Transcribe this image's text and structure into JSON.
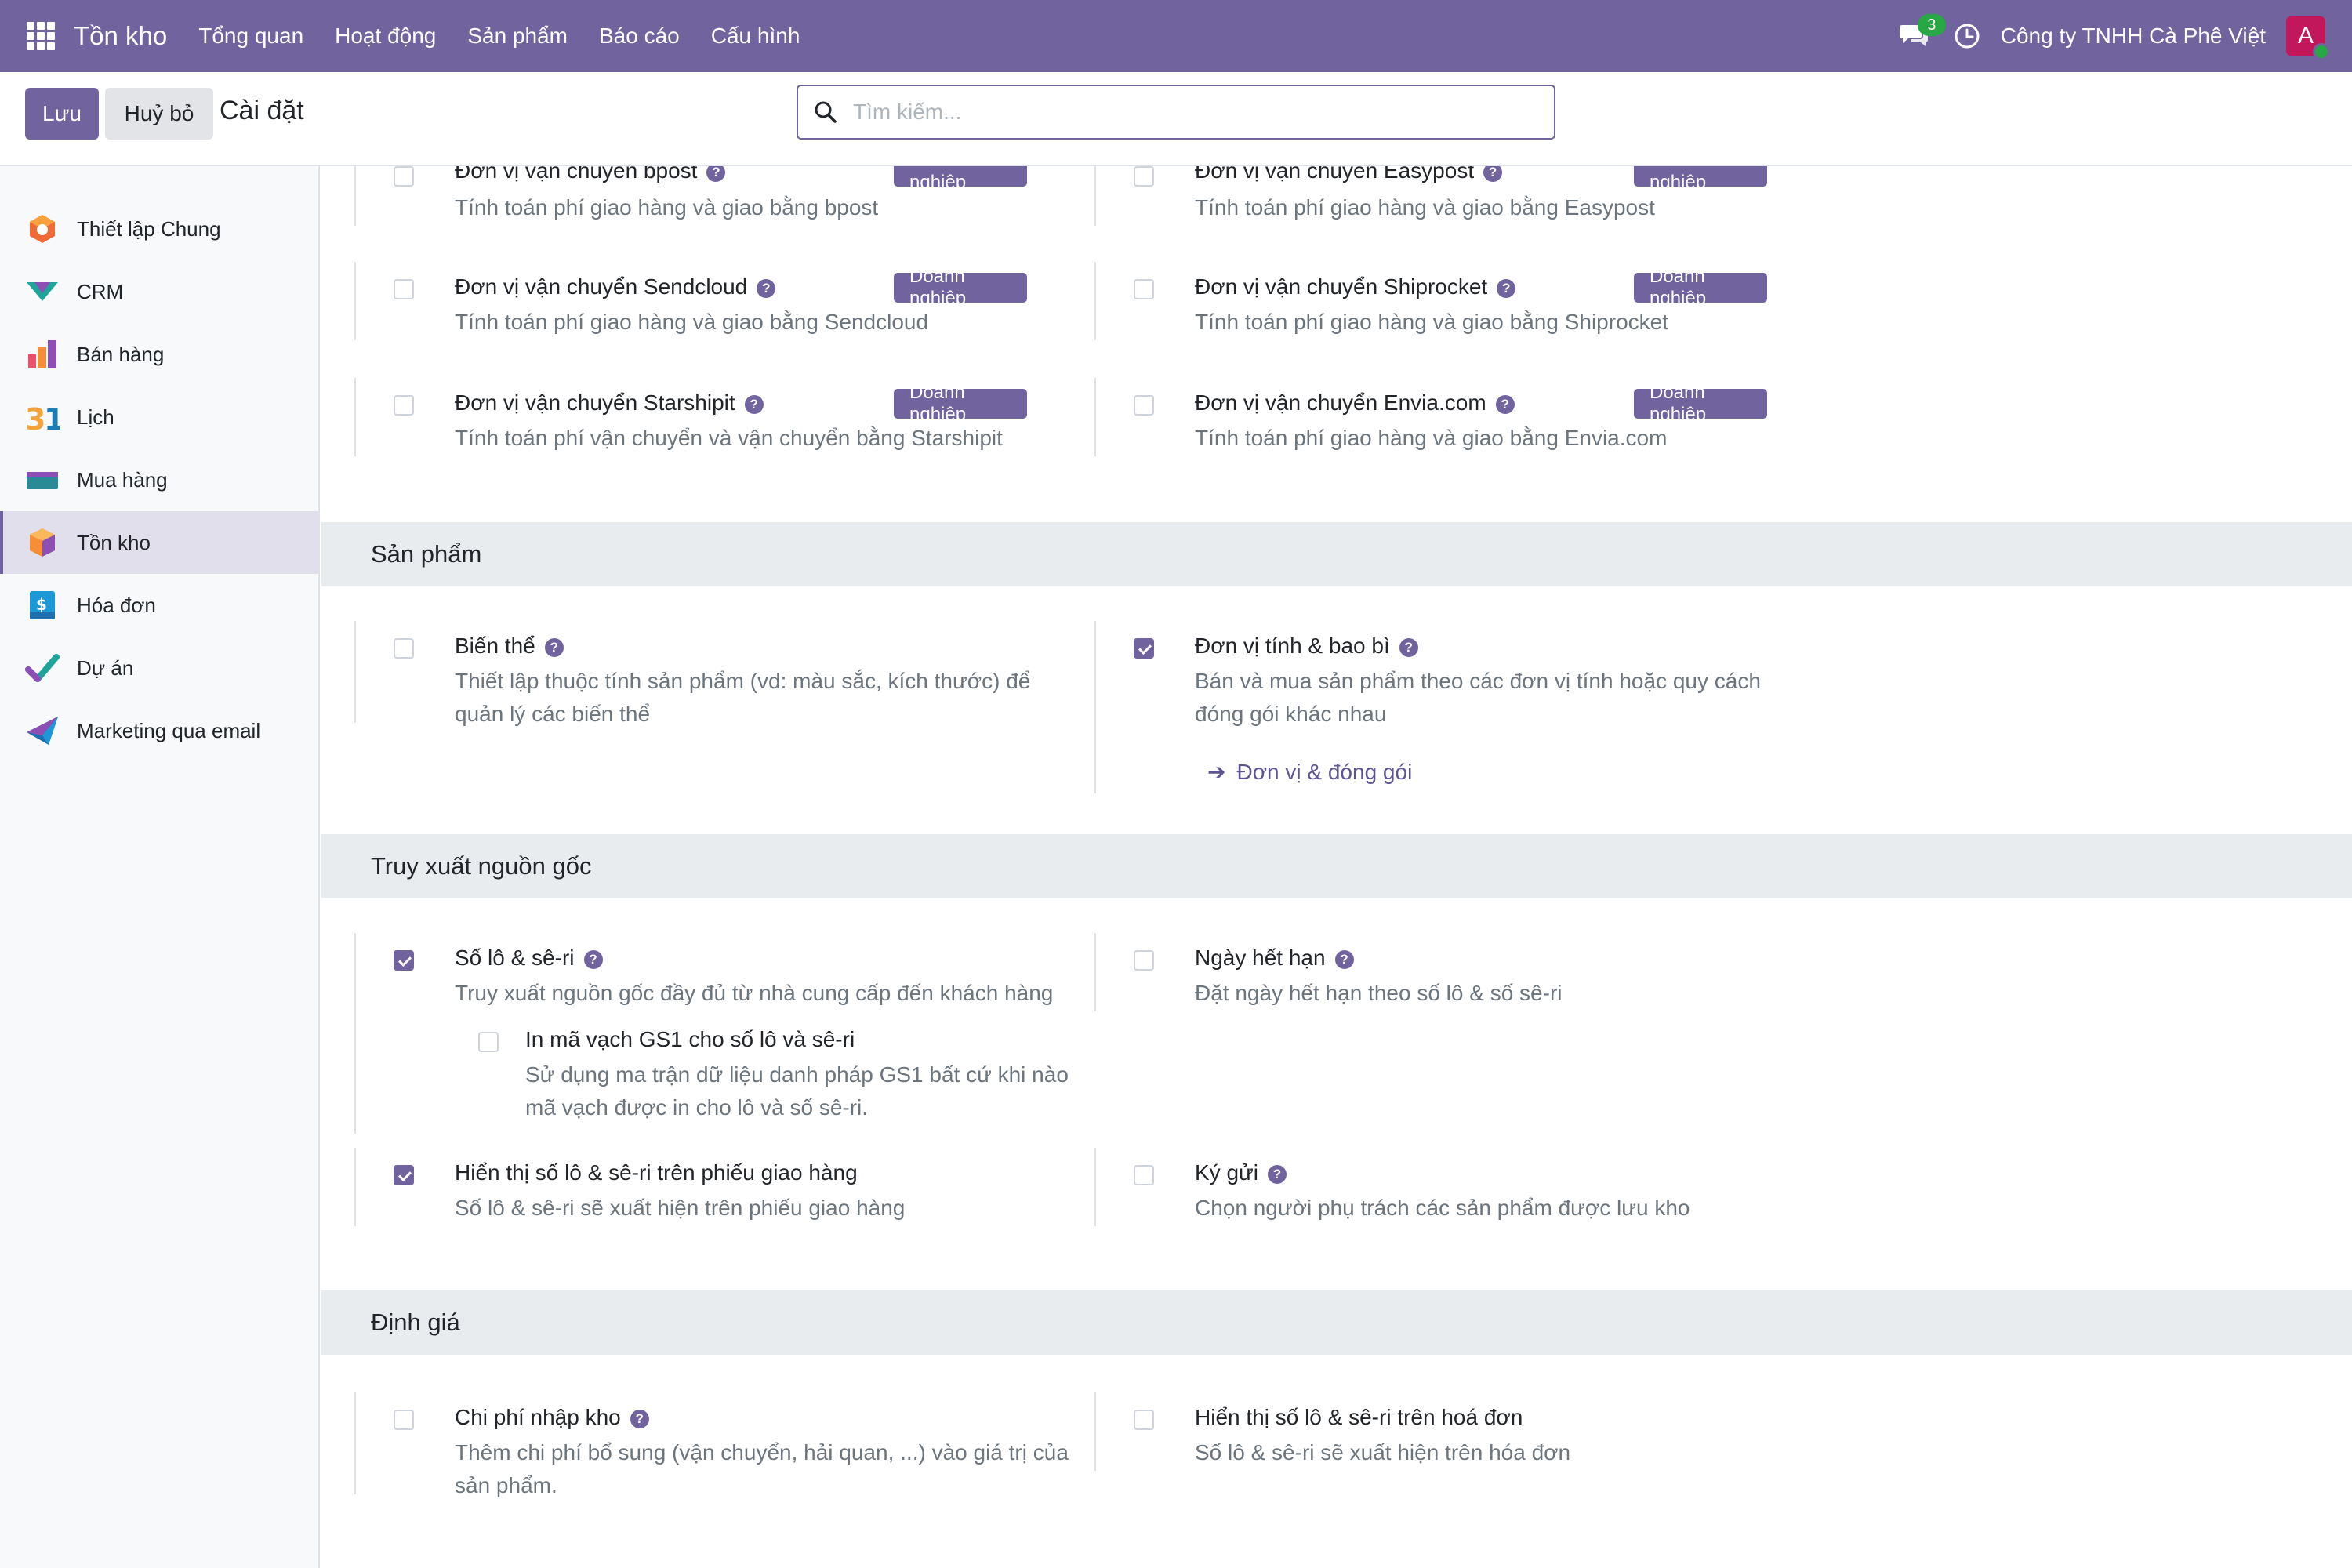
{
  "navbar": {
    "brand": "Tồn kho",
    "menu": [
      "Tổng quan",
      "Hoạt động",
      "Sản phẩm",
      "Báo cáo",
      "Cấu hình"
    ],
    "chat_count": "3",
    "company": "Công ty TNHH Cà Phê Việt",
    "avatar_letter": "A"
  },
  "control": {
    "save_label": "Lưu",
    "cancel_label": "Huỷ bỏ",
    "title": "Cài đặt",
    "search_placeholder": "Tìm kiếm..."
  },
  "sidebar": {
    "items": [
      {
        "label": "Thiết lập Chung",
        "icon": "settings-app-icon"
      },
      {
        "label": "CRM",
        "icon": "crm-app-icon"
      },
      {
        "label": "Bán hàng",
        "icon": "sales-app-icon"
      },
      {
        "label": "Lịch",
        "icon": "calendar-app-icon"
      },
      {
        "label": "Mua hàng",
        "icon": "purchase-app-icon"
      },
      {
        "label": "Tồn kho",
        "icon": "inventory-app-icon",
        "active": true
      },
      {
        "label": "Hóa đơn",
        "icon": "invoicing-app-icon"
      },
      {
        "label": "Dự án",
        "icon": "project-app-icon"
      },
      {
        "label": "Marketing qua email",
        "icon": "email-marketing-app-icon"
      }
    ]
  },
  "shipping": {
    "bpost": {
      "title": "Đơn vị vận chuyển bpost",
      "desc": "Tính toán phí giao hàng và giao bằng bpost",
      "badge": "Doanh nghiệp",
      "checked": false
    },
    "easypost": {
      "title": "Đơn vị vận chuyển Easypost",
      "desc": "Tính toán phí giao hàng và giao bằng Easypost",
      "badge": "Doanh nghiệp",
      "checked": false
    },
    "sendcloud": {
      "title": "Đơn vị vận chuyển Sendcloud",
      "desc": "Tính toán phí giao hàng và giao bằng Sendcloud",
      "badge": "Doanh nghiệp",
      "checked": false
    },
    "shiprocket": {
      "title": "Đơn vị vận chuyển Shiprocket",
      "desc": "Tính toán phí giao hàng và giao bằng Shiprocket",
      "badge": "Doanh nghiệp",
      "checked": false
    },
    "starshipit": {
      "title": "Đơn vị vận chuyển Starshipit",
      "desc": "Tính toán phí vận chuyển và vận chuyển bằng Starshipit",
      "badge": "Doanh nghiệp",
      "checked": false
    },
    "envia": {
      "title": "Đơn vị vận chuyển Envia.com",
      "desc": "Tính toán phí giao hàng và giao bằng Envia.com",
      "badge": "Doanh nghiệp",
      "checked": false
    }
  },
  "products": {
    "heading": "Sản phẩm",
    "variants": {
      "title": "Biến thể",
      "desc1": "Thiết lập thuộc tính sản phẩm (vd: màu sắc, kích thước) để",
      "desc2": "quản lý các biến thể",
      "checked": false
    },
    "uom": {
      "title": "Đơn vị tính & bao bì",
      "desc1": "Bán và mua sản phẩm theo các đơn vị tính hoặc quy cách",
      "desc2": "đóng gói khác nhau",
      "link": "Đơn vị & đóng gói",
      "checked": true
    }
  },
  "traceability": {
    "heading": "Truy xuất nguồn gốc",
    "lots": {
      "title": "Số lô & sê-ri",
      "desc": "Truy xuất nguồn gốc đầy đủ từ nhà cung cấp đến khách hàng",
      "checked": true
    },
    "gs1": {
      "title": "In mã vạch GS1 cho số lô và sê-ri",
      "desc1": "Sử dụng ma trận dữ liệu danh pháp GS1 bất cứ khi nào",
      "desc2": "mã vạch được in cho lô và số sê-ri.",
      "checked": false
    },
    "expiry": {
      "title": "Ngày hết hạn",
      "desc": "Đặt ngày hết hạn theo số lô & số sê-ri",
      "checked": false
    },
    "delivery_slip": {
      "title": "Hiển thị số lô & sê-ri trên phiếu giao hàng",
      "desc": "Số lô & sê-ri sẽ xuất hiện trên phiếu giao hàng",
      "checked": true
    },
    "consignment": {
      "title": "Ký gửi",
      "desc": "Chọn người phụ trách các sản phẩm được lưu kho",
      "checked": false
    }
  },
  "valuation": {
    "heading": "Định giá",
    "landed": {
      "title": "Chi phí nhập kho",
      "desc1": "Thêm chi phí bổ sung (vận chuyển, hải quan, ...) vào giá trị của",
      "desc2": "sản phẩm.",
      "checked": false
    },
    "invoice_lots": {
      "title": "Hiển thị số lô & sê-ri trên hoá đơn",
      "desc": "Số lô & sê-ri sẽ xuất hiện trên hóa đơn",
      "checked": false
    }
  },
  "colors": {
    "brand": "#71639e",
    "section_bg": "#e9ecef",
    "muted_text": "#6c757d"
  }
}
